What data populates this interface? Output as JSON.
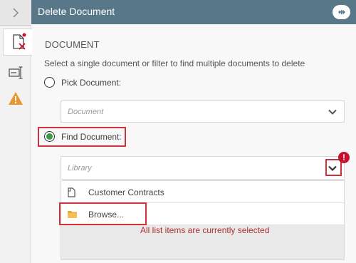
{
  "header": {
    "title": "Delete Document",
    "action_icon": "plus-pill-icon"
  },
  "rail": {
    "collapse_icon": "chevron-right-icon",
    "tabs": [
      {
        "icon": "document-delete-icon",
        "active": true,
        "has_alert_dot": true
      },
      {
        "icon": "text-field-icon",
        "active": false
      },
      {
        "icon": "warning-icon",
        "active": false
      }
    ]
  },
  "section": {
    "title": "DOCUMENT",
    "description": "Select a single document or filter to find multiple documents to delete"
  },
  "options": {
    "pick_label": "Pick Document:",
    "find_label": "Find Document:",
    "selected": "find"
  },
  "document_select": {
    "placeholder": "Document"
  },
  "library_select": {
    "placeholder": "Library",
    "error_badge": "!"
  },
  "list": {
    "items": [
      {
        "label": "Customer Contracts",
        "icon": "document-icon"
      },
      {
        "label": "Browse...",
        "icon": "folder-icon"
      }
    ],
    "message": "All list items are currently selected"
  },
  "colors": {
    "header": "#587788",
    "accent_green": "#3b9a46",
    "highlight_red": "#d2303a",
    "error_text": "#b03030",
    "warning": "#e8962e"
  }
}
